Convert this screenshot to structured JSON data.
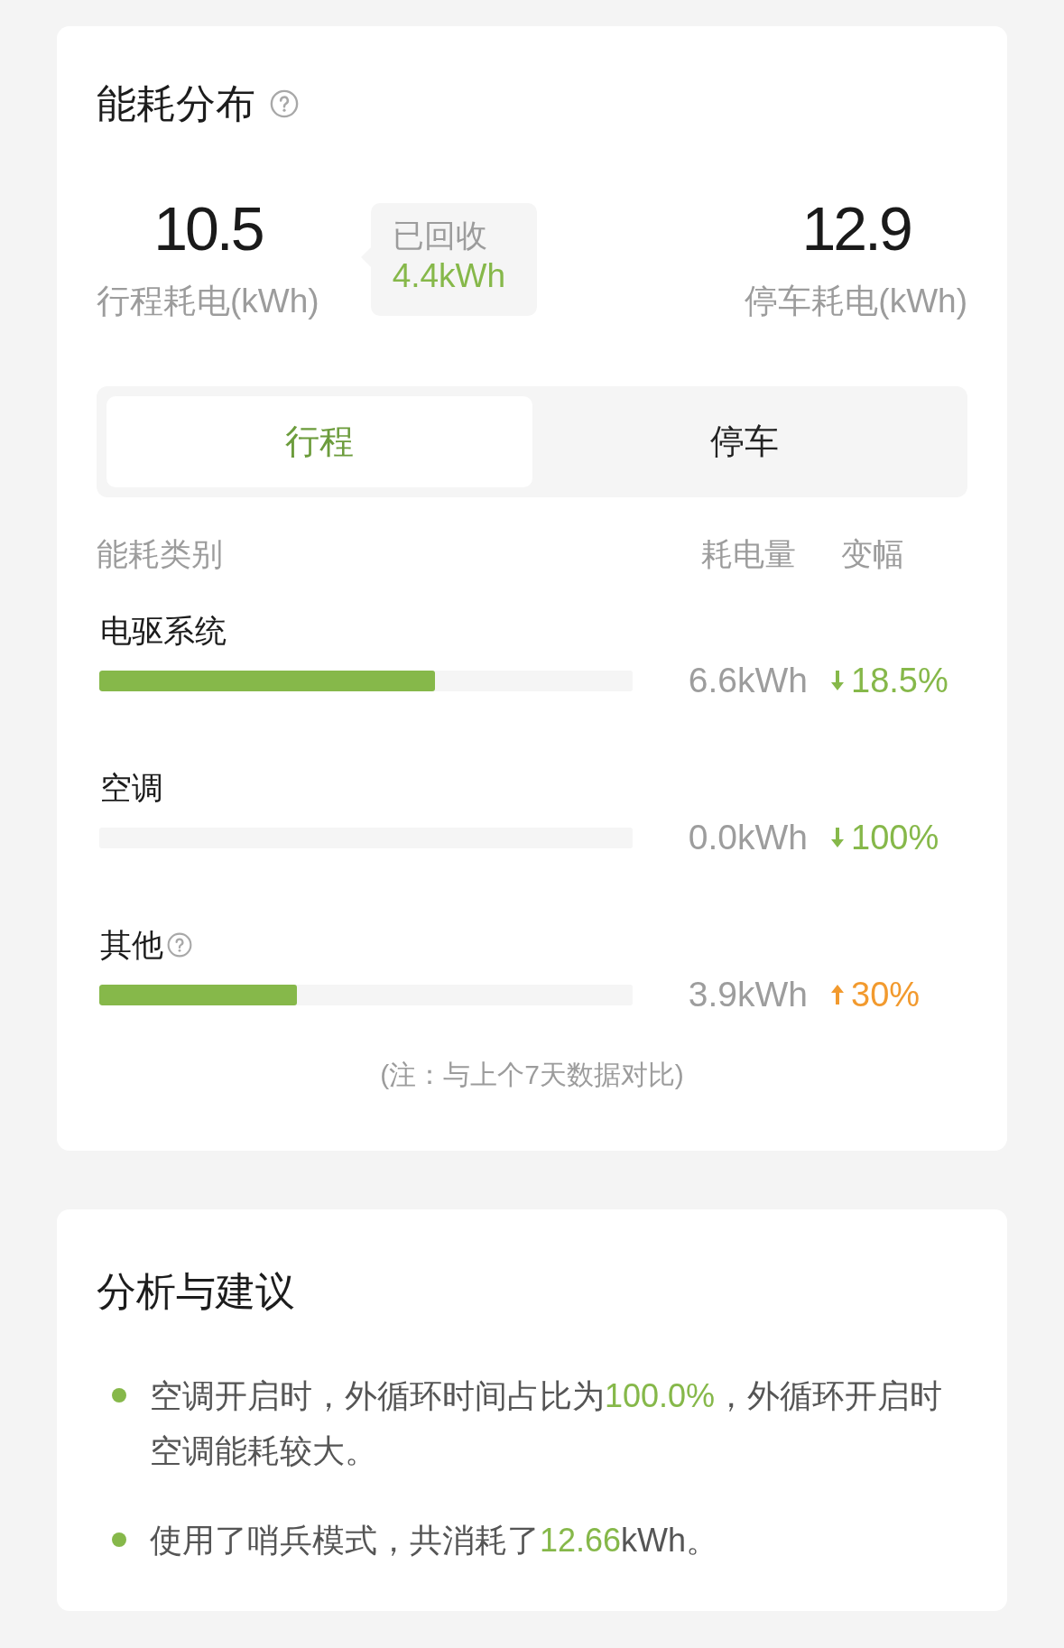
{
  "energy_card": {
    "title": "能耗分布",
    "trip": {
      "value": "10.5",
      "label": "行程耗电(kWh)"
    },
    "recovered": {
      "label": "已回收",
      "value": "4.4kWh"
    },
    "parked": {
      "value": "12.9",
      "label": "停车耗电(kWh)"
    },
    "tabs": [
      {
        "label": "行程",
        "selected": true
      },
      {
        "label": "停车",
        "selected": false
      }
    ],
    "columns": [
      "能耗类别",
      "耗电量",
      "变幅"
    ],
    "rows": [
      {
        "name": "电驱系统",
        "info_icon": false,
        "level": 0.63,
        "usage": "6.6kWh",
        "rising": false,
        "change": "18.5%"
      },
      {
        "name": "空调",
        "info_icon": false,
        "usage": "0.0kWh",
        "rising": false,
        "change": "100%"
      },
      {
        "name": "其他",
        "info_icon": true,
        "level": 0.37,
        "usage": "3.9kWh",
        "rising": true,
        "change": "30%"
      }
    ],
    "note": "(注：与上个7天数据对比)"
  },
  "analysis_card": {
    "title": "分析与建议",
    "items": [
      {
        "segments": [
          {
            "text": "空调开启时，外循环时间占比为",
            "highlight": false
          },
          {
            "text": "100.0%",
            "highlight": true
          },
          {
            "text": "，外循环开启时空调能耗较大。",
            "highlight": false
          }
        ]
      },
      {
        "segments": [
          {
            "text": "使用了哨兵模式，共消耗了",
            "highlight": false
          },
          {
            "text": "12.66",
            "highlight": true
          },
          {
            "text": "kWh。",
            "highlight": false
          }
        ]
      }
    ]
  }
}
